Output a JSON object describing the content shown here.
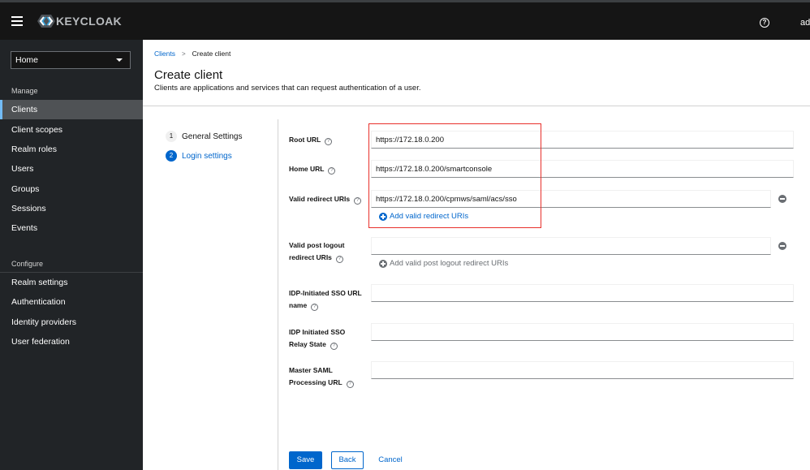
{
  "header": {
    "brand": "KEYCLOAK",
    "user": "admin",
    "icons": {
      "menu": "hamburger-icon",
      "help": "help-icon"
    }
  },
  "sidebar": {
    "realm_selector": {
      "value": "Home"
    },
    "sections": [
      {
        "title": "Manage",
        "items": [
          {
            "label": "Clients",
            "active": true
          },
          {
            "label": "Client scopes"
          },
          {
            "label": "Realm roles"
          },
          {
            "label": "Users"
          },
          {
            "label": "Groups"
          },
          {
            "label": "Sessions"
          },
          {
            "label": "Events"
          }
        ]
      },
      {
        "title": "Configure",
        "items": [
          {
            "label": "Realm settings"
          },
          {
            "label": "Authentication"
          },
          {
            "label": "Identity providers"
          },
          {
            "label": "User federation"
          }
        ]
      }
    ]
  },
  "breadcrumb": {
    "parent": "Clients",
    "separator": ">",
    "current": "Create client"
  },
  "page": {
    "title": "Create client",
    "description": "Clients are applications and services that can request authentication of a user."
  },
  "wizard": {
    "steps": [
      {
        "number": "1",
        "label": "General Settings",
        "state": "inactive"
      },
      {
        "number": "2",
        "label": "Login settings",
        "state": "current"
      }
    ]
  },
  "form": {
    "help_glyph": "?",
    "root_url": {
      "label": "Root URL",
      "value": "https://172.18.0.200"
    },
    "home_url": {
      "label": "Home URL",
      "value": "https://172.18.0.200/smartconsole"
    },
    "valid_redirect_uris": {
      "label": "Valid redirect URIs",
      "values": [
        "https://172.18.0.200/cpmws/saml/acs/sso"
      ],
      "add_label": "Add valid redirect URIs"
    },
    "valid_post_logout_redirect_uris": {
      "label_line1": "Valid post logout",
      "label_line2": "redirect URIs",
      "values": [
        ""
      ],
      "add_label": "Add valid post logout redirect URIs"
    },
    "idp_initiated_sso_url_name": {
      "label_line1": "IDP-Initiated SSO URL",
      "label_line2": "name",
      "value": ""
    },
    "idp_initiated_sso_relay_state": {
      "label_line1": "IDP Initiated SSO",
      "label_line2": "Relay State",
      "value": ""
    },
    "master_saml_processing_url": {
      "label_line1": "Master SAML",
      "label_line2": "Processing URL",
      "value": ""
    }
  },
  "actions": {
    "save": "Save",
    "back": "Back",
    "cancel": "Cancel"
  },
  "annotation": {
    "color": "#e8302b"
  },
  "colors": {
    "primary": "#0066cc",
    "header_bg": "#151515",
    "sidebar_bg": "#212427",
    "active_nav": "#4f5255",
    "active_accent": "#73bcf7"
  }
}
